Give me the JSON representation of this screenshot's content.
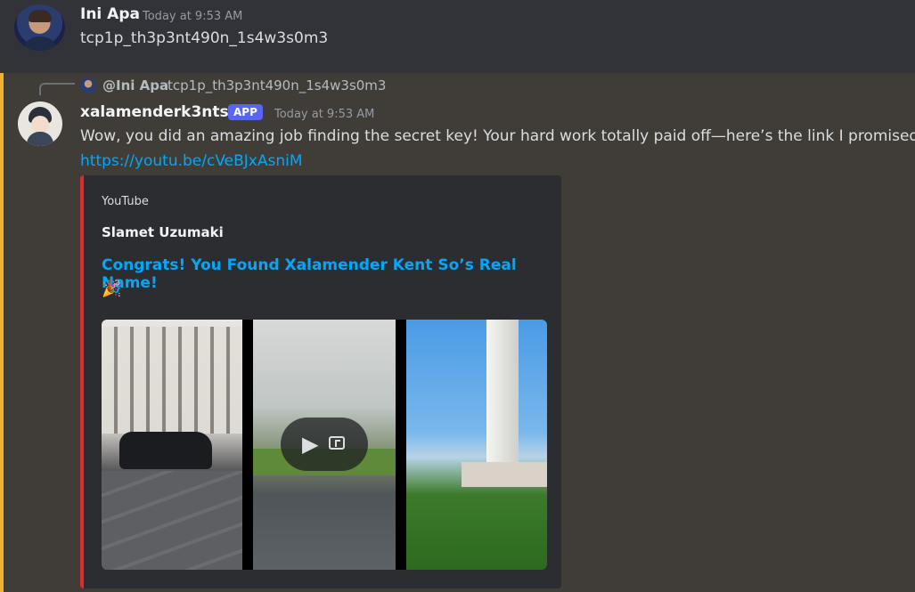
{
  "messages": [
    {
      "username": "Ini Apa",
      "timestamp": "Today at 9:53 AM",
      "content": "tcp1p_th3p3nt490n_1s4w3s0m3"
    },
    {
      "reply": {
        "username": "@Ini Apa",
        "content": "tcp1p_th3p3nt490n_1s4w3s0m3"
      },
      "username": "xalamenderk3nts0",
      "badge": "APP",
      "timestamp": "Today at 9:53 AM",
      "content": "Wow, you did an amazing job finding the secret key! Your hard work totally paid off—here’s the link I promised:",
      "link": "https://youtu.be/cVeBJxAsniM",
      "embed": {
        "provider": "YouTube",
        "author": "Slamet Uzumaki",
        "title": "Congrats! You Found Xalamender Kent So’s Real Name!",
        "emoji": "🎉",
        "accent_color": "#e02b2b",
        "video_controls": [
          "play-icon",
          "popout-icon"
        ]
      }
    }
  ],
  "colors": {
    "highlight_bar": "#f0b232",
    "link": "#00a8fc",
    "app_badge": "#5865f2"
  }
}
